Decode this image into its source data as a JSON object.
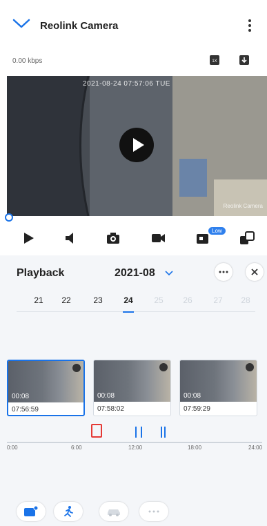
{
  "header": {
    "title": "Reolink Camera"
  },
  "stream": {
    "bitrate": "0.00 kbps"
  },
  "video": {
    "osd_date": "2021-08-24 07:57:06 TUE",
    "osd_name": "Reolink Camera"
  },
  "controls": {
    "quality_badge": "Low"
  },
  "playback": {
    "title": "Playback",
    "month": "2021-08",
    "days": [
      {
        "label": "21",
        "state": "normal"
      },
      {
        "label": "22",
        "state": "normal"
      },
      {
        "label": "23",
        "state": "normal"
      },
      {
        "label": "24",
        "state": "active"
      },
      {
        "label": "25",
        "state": "future"
      },
      {
        "label": "26",
        "state": "future"
      },
      {
        "label": "27",
        "state": "future"
      },
      {
        "label": "28",
        "state": "future"
      }
    ],
    "clips": [
      {
        "duration": "00:08",
        "time": "07:56:59",
        "selected": true
      },
      {
        "duration": "00:08",
        "time": "07:58:02",
        "selected": false
      },
      {
        "duration": "00:08",
        "time": "07:59:29",
        "selected": false
      }
    ],
    "timeline_ticks": [
      "0:00",
      "6:00",
      "12:00",
      "18:00",
      "24:00"
    ]
  },
  "colors": {
    "accent": "#1a73e8",
    "marker": "#e53935",
    "panel_bg": "#f4f6f9"
  }
}
